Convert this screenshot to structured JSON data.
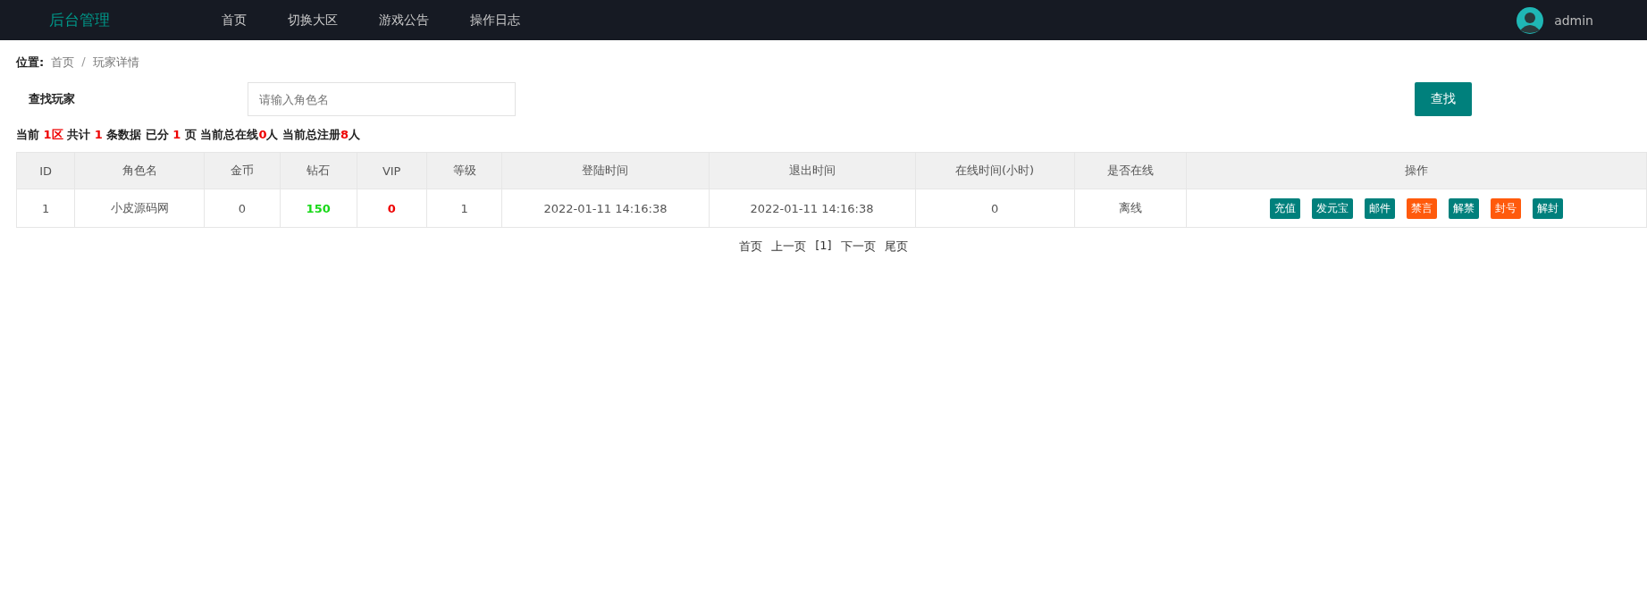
{
  "header": {
    "logo": "后台管理",
    "nav": [
      {
        "label": "首页"
      },
      {
        "label": "切换大区"
      },
      {
        "label": "游戏公告"
      },
      {
        "label": "操作日志"
      }
    ],
    "user": "admin"
  },
  "breadcrumb": {
    "label": "位置:",
    "items": [
      "首页",
      "玩家详情"
    ],
    "separator": "/"
  },
  "search": {
    "label": "查找玩家",
    "placeholder": "请输入角色名",
    "button": "查找"
  },
  "summary": [
    {
      "text": "当前 ",
      "highlight": false
    },
    {
      "text": "1区",
      "highlight": true
    },
    {
      "text": " 共计 ",
      "highlight": false
    },
    {
      "text": "1",
      "highlight": true
    },
    {
      "text": " 条数据 已分 ",
      "highlight": false
    },
    {
      "text": "1",
      "highlight": true
    },
    {
      "text": " 页 当前总在线",
      "highlight": false
    },
    {
      "text": "0",
      "highlight": true
    },
    {
      "text": "人 当前总注册",
      "highlight": false
    },
    {
      "text": "8",
      "highlight": true
    },
    {
      "text": "人",
      "highlight": false
    }
  ],
  "table": {
    "columns": [
      "ID",
      "角色名",
      "金币",
      "钻石",
      "VIP",
      "等级",
      "登陆时间",
      "退出时间",
      "在线时间(小时)",
      "是否在线",
      "操作"
    ],
    "rows": [
      {
        "cells": [
          {
            "text": "1",
            "kind": "plain"
          },
          {
            "text": "小皮源码网",
            "kind": "plain"
          },
          {
            "text": "0",
            "kind": "plain"
          },
          {
            "text": "150",
            "kind": "good"
          },
          {
            "text": "0",
            "kind": "bad"
          },
          {
            "text": "1",
            "kind": "plain"
          },
          {
            "text": "2022-01-11 14:16:38",
            "kind": "plain"
          },
          {
            "text": "2022-01-11 14:16:38",
            "kind": "plain"
          },
          {
            "text": "0",
            "kind": "plain"
          },
          {
            "text": "离线",
            "kind": "plain"
          }
        ],
        "actions": [
          {
            "label": "充值",
            "color": "#00807c"
          },
          {
            "label": "发元宝",
            "color": "#00807c"
          },
          {
            "label": "邮件",
            "color": "#00807c"
          },
          {
            "label": "禁言",
            "color": "#ff5a0c"
          },
          {
            "label": "解禁",
            "color": "#00807c"
          },
          {
            "label": "封号",
            "color": "#ff5a0c"
          },
          {
            "label": "解封",
            "color": "#00807c"
          }
        ]
      }
    ]
  },
  "pagination": [
    "首页",
    "上一页",
    "[1]",
    "下一页",
    "尾页"
  ]
}
